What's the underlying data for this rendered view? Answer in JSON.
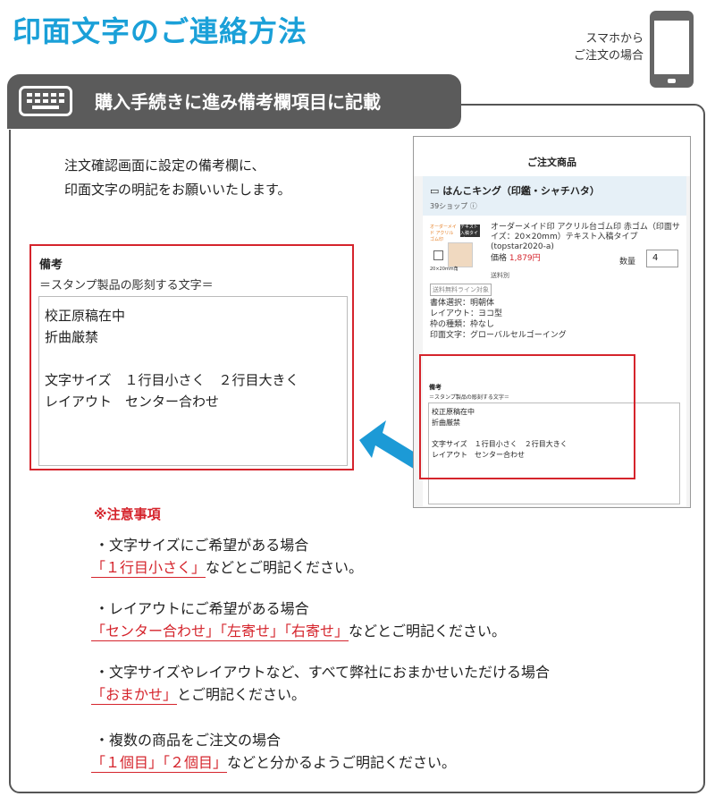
{
  "page_title": "印面文字のご連絡方法",
  "smartphone_note": [
    "スマホから",
    "ご注文の場合"
  ],
  "step": {
    "title": "購入手続きに進み備考欄項目に記載"
  },
  "intro": [
    "注文確認画面に設定の備考欄に、",
    "印面文字の明記をお願いいたします。"
  ],
  "remarks_example": {
    "label": "備考",
    "subtitle": "＝スタンプ製品の彫刻する文字＝",
    "lines": [
      "校正原稿在中",
      "折曲厳禁",
      "",
      "文字サイズ　１行目小さく　２行目大きく",
      "レイアウト　センター合わせ"
    ]
  },
  "screenshot": {
    "header": "ご注文商品",
    "shop_name": "はんこキング（印鑑・シャチハタ）",
    "shop_count": "39ショップ",
    "thumb1_text": "オーダーメイド アクリルゴム印",
    "thumb2_text": "テキスト 入稿タイプ",
    "thumb_size": "20×20mm角",
    "product_name": "オーダーメイド印 アクリル台ゴム印 赤ゴム（印面サイズ：20×20mm）テキスト入稿タイプ (topstar2020-a)",
    "product_name_extra": "面サイ",
    "price_label": "価格",
    "price_value": "1,879円",
    "shipping": "送料別",
    "qty_label": "数量",
    "qty_value": "4",
    "badge": "送料無料ライン対象",
    "options": [
      "書体選択：明朝体",
      "レイアウト：ヨコ型",
      "枠の種類：枠なし",
      "印面文字：グローバルセルゴーイング"
    ],
    "remarks_label": "備考",
    "remarks_subtitle": "＝スタンプ製品の彫刻する文字＝",
    "remarks_lines": [
      "校正原稿在中",
      "折曲厳禁",
      "",
      "文字サイズ　１行目小さく　２行目大きく",
      "レイアウト　センター合わせ"
    ]
  },
  "notes": {
    "title": "※注意事項",
    "items": [
      {
        "line1": "・文字サイズにご希望がある場合",
        "highlight": "「１行目小さく」",
        "rest": "などとご明記ください。"
      },
      {
        "line1": "・レイアウトにご希望がある場合",
        "highlight": "「センター合わせ」「左寄せ」「右寄せ」",
        "rest": "などとご明記ください。"
      },
      {
        "line1": "・文字サイズやレイアウトなど、すべて弊社におまかせいただける場合",
        "highlight": "「おまかせ」",
        "rest": "とご明記ください。"
      },
      {
        "line1": "・複数の商品をご注文の場合",
        "highlight": "「１個目」「２個目」",
        "rest": "などと分かるようご明記ください。"
      }
    ]
  },
  "colors": {
    "title_blue": "#1aa0d8",
    "accent_red": "#d5242c",
    "arrow_blue": "#1c9ad6",
    "tab_gray": "#5b5b5b"
  },
  "icons": [
    "keyboard-icon",
    "smartphone-icon",
    "shop-icon",
    "info-icon",
    "arrow-left-icon"
  ]
}
